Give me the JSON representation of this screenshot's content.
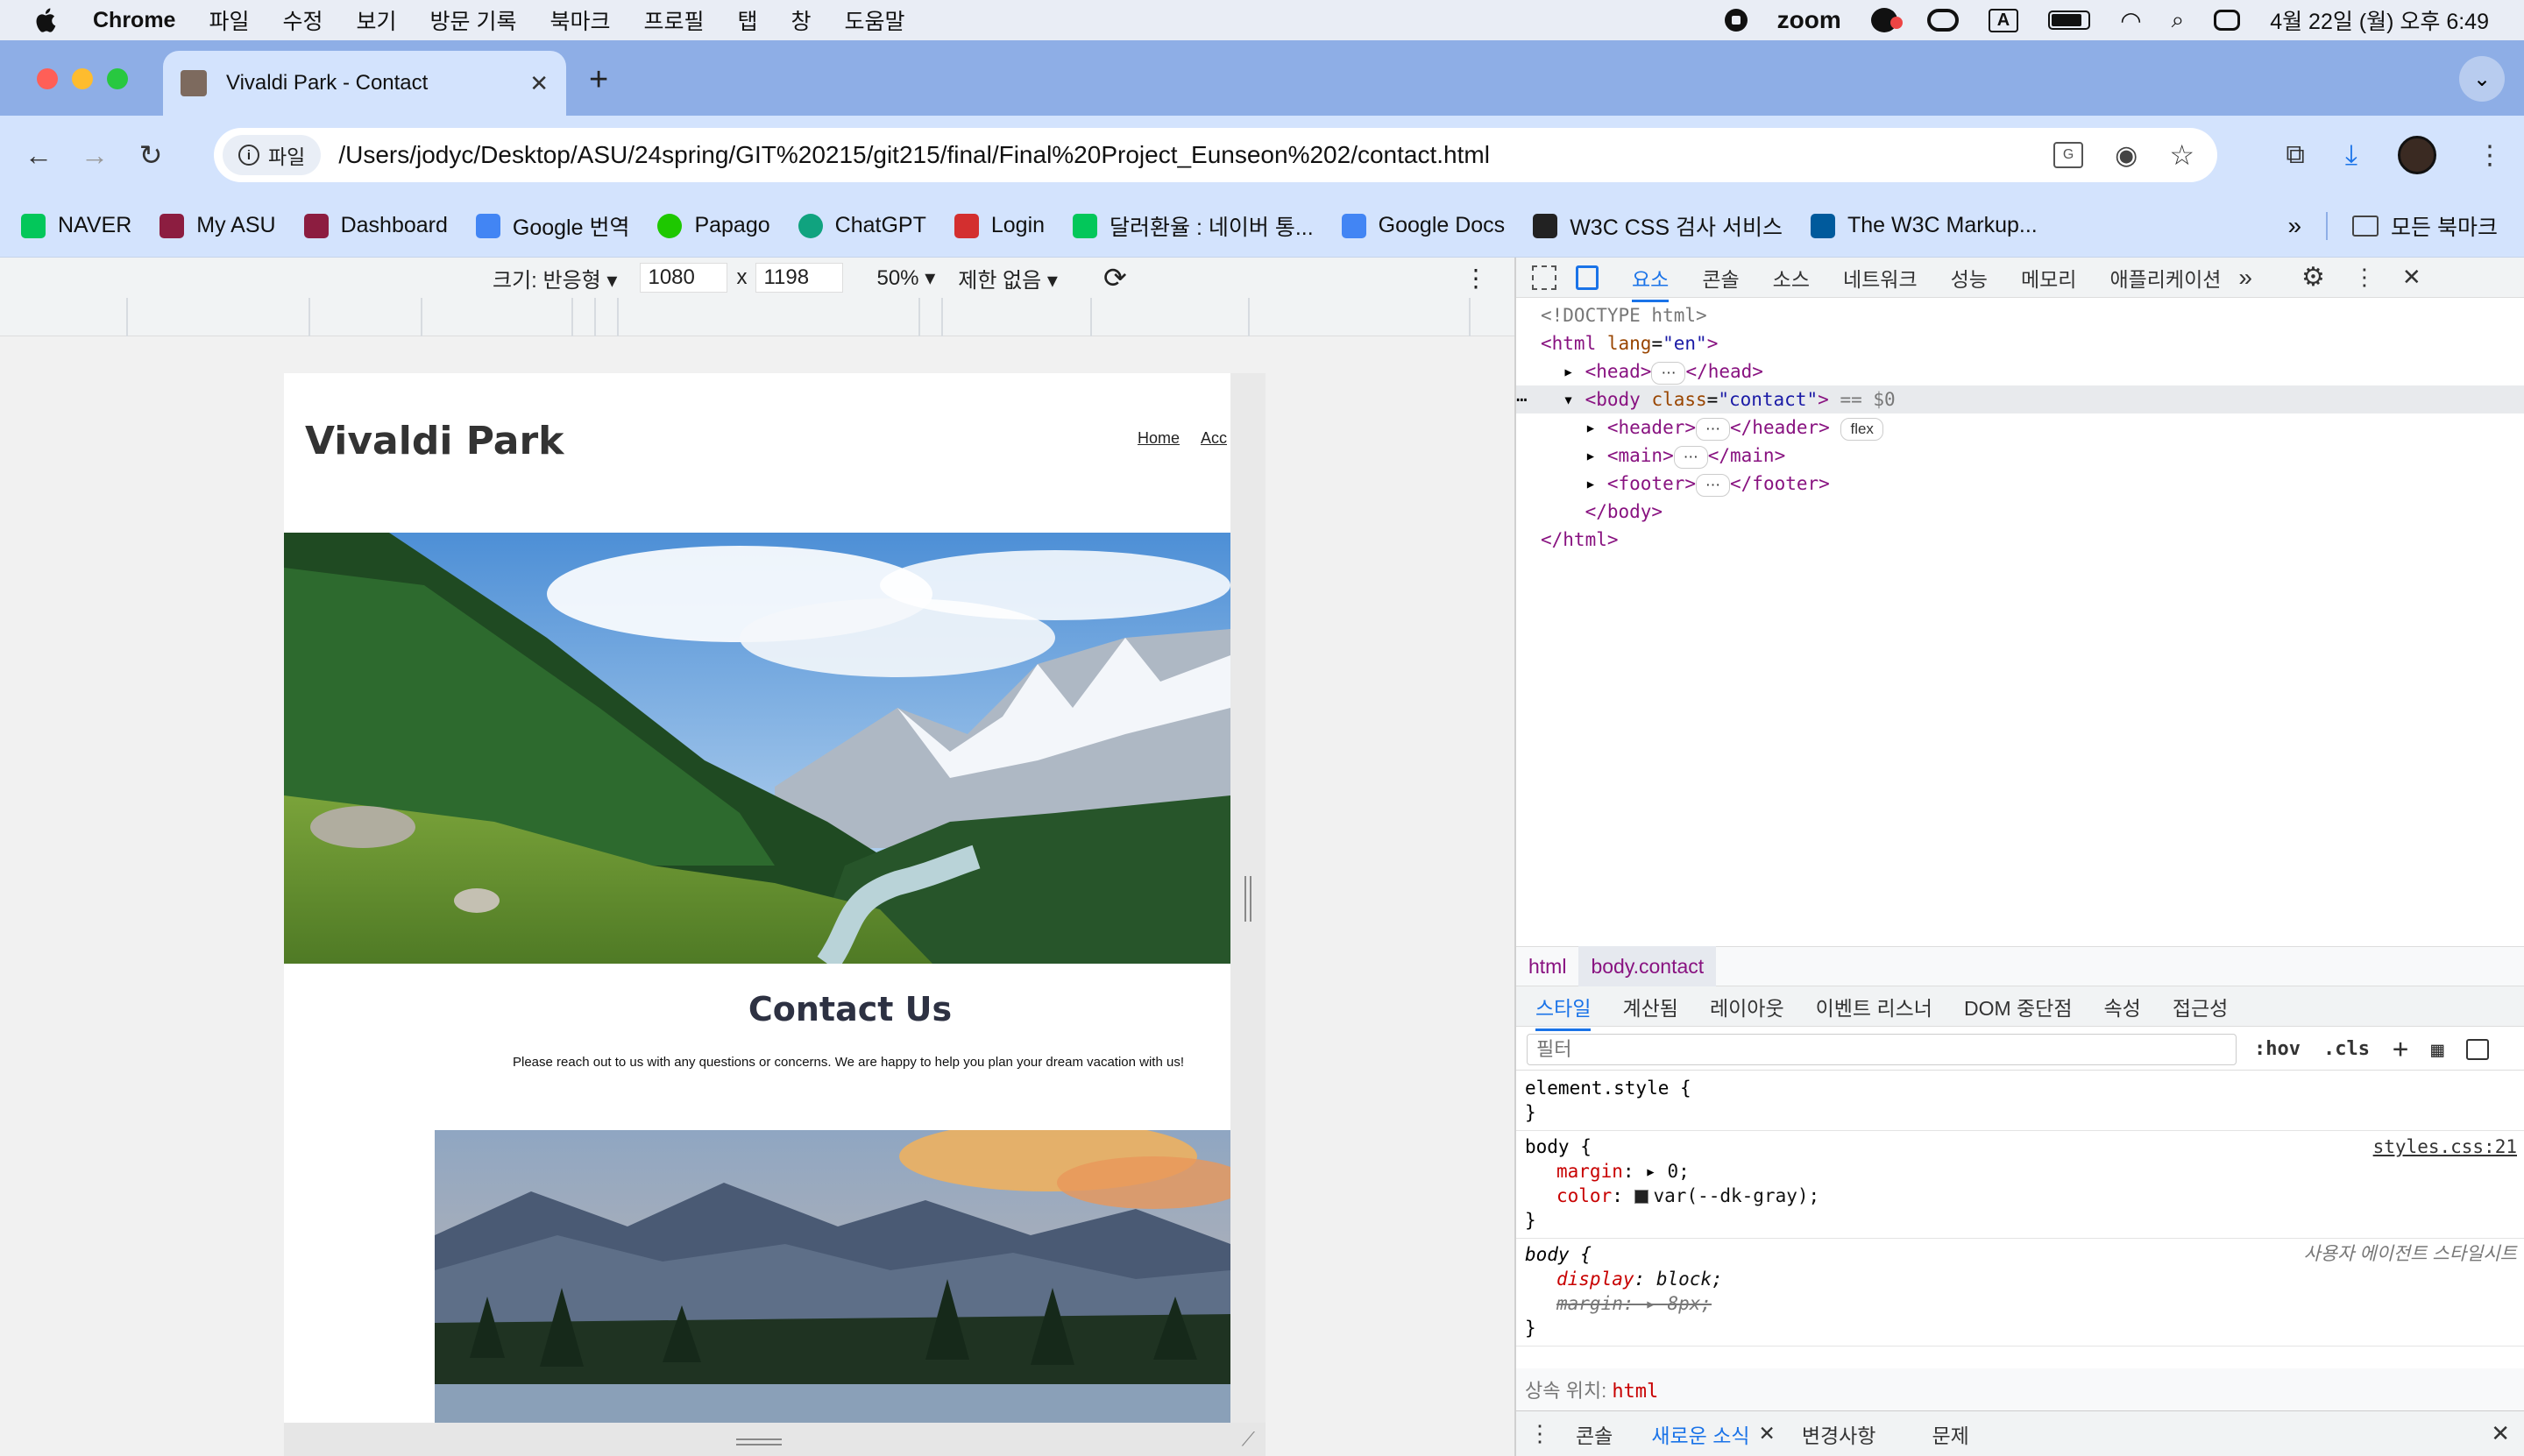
{
  "menubar": {
    "app": "Chrome",
    "items": [
      "파일",
      "수정",
      "보기",
      "방문 기록",
      "북마크",
      "프로필",
      "탭",
      "창",
      "도움말"
    ],
    "zoom": "zoom",
    "clock": "4월 22일 (월) 오후 6:49"
  },
  "browser": {
    "tab_title": "Vivaldi Park - Contact",
    "chip_label": "파일",
    "url": "/Users/jodyc/Desktop/ASU/24spring/GIT%20215/git215/final/Final%20Project_Eunseon%202/contact.html",
    "bookmarks": [
      {
        "label": "NAVER",
        "color": "#03c75a"
      },
      {
        "label": "My ASU",
        "color": "#8c1d40"
      },
      {
        "label": "Dashboard",
        "color": "#8c1d40"
      },
      {
        "label": "Google 번역",
        "color": "#4285f4"
      },
      {
        "label": "Papago",
        "color": "#1ec800"
      },
      {
        "label": "ChatGPT",
        "color": "#10a37f"
      },
      {
        "label": "Login",
        "color": "#d32f2f"
      },
      {
        "label": "달러환율 : 네이버 통...",
        "color": "#03c75a"
      },
      {
        "label": "Google Docs",
        "color": "#4285f4"
      },
      {
        "label": "W3C CSS 검사 서비스",
        "color": "#222222"
      },
      {
        "label": "The W3C Markup...",
        "color": "#005a9c"
      }
    ],
    "all_bookmarks": "모든 북마크"
  },
  "device_toolbar": {
    "size_label": "크기: 반응형",
    "width": "1080",
    "times": "x",
    "height": "1198",
    "zoom": "50%",
    "throttle": "제한 없음"
  },
  "site": {
    "title": "Vivaldi Park",
    "nav_home": "Home",
    "nav_acc": "Acc",
    "contact_heading": "Contact Us",
    "contact_text": "Please reach out to us with any questions or concerns. We are happy to help you plan your dream vacation with us!"
  },
  "devtools": {
    "tabs": [
      "요소",
      "콘솔",
      "소스",
      "네트워크",
      "성능",
      "메모리",
      "애플리케이션"
    ],
    "active_tab": "요소",
    "dom": {
      "doctype": "<!DOCTYPE html>",
      "html_open": "<html",
      "lang_attr": "lang",
      "lang_val": "\"en\"",
      "head": "<head>",
      "head_close": "</head>",
      "body_open": "<body",
      "class_attr": "class",
      "class_val": "\"contact\"",
      "eq": "== $0",
      "header": "<header>",
      "header_close": "</header>",
      "flex_badge": "flex",
      "main": "<main>",
      "main_close": "</main>",
      "footer": "<footer>",
      "footer_close": "</footer>",
      "body_close": "</body>",
      "html_close": "</html>"
    },
    "breadcrumb": [
      "html",
      "body.contact"
    ],
    "subtabs": [
      "스타일",
      "계산됨",
      "레이아웃",
      "이벤트 리스너",
      "DOM 중단점",
      "속성",
      "접근성"
    ],
    "filter_placeholder": "필터",
    "filter_buttons": [
      ":hov",
      ".cls"
    ],
    "rules": {
      "element_style": "element.style {",
      "close": "}",
      "body_sel": "body {",
      "body_src": "styles.css:21",
      "margin_name": "margin",
      "margin_val": "0;",
      "color_name": "color",
      "color_val": "var(--dk-gray);",
      "ua_src": "사용자 에이전트 스타일시트",
      "display_name": "display",
      "display_val": "block;",
      "ua_margin_name": "margin",
      "ua_margin_val": "8px;"
    },
    "inherit_label": "상속 위치:",
    "inherit_from": "html",
    "drawer": [
      "콘솔",
      "새로운 소식",
      "변경사항",
      "문제"
    ]
  }
}
